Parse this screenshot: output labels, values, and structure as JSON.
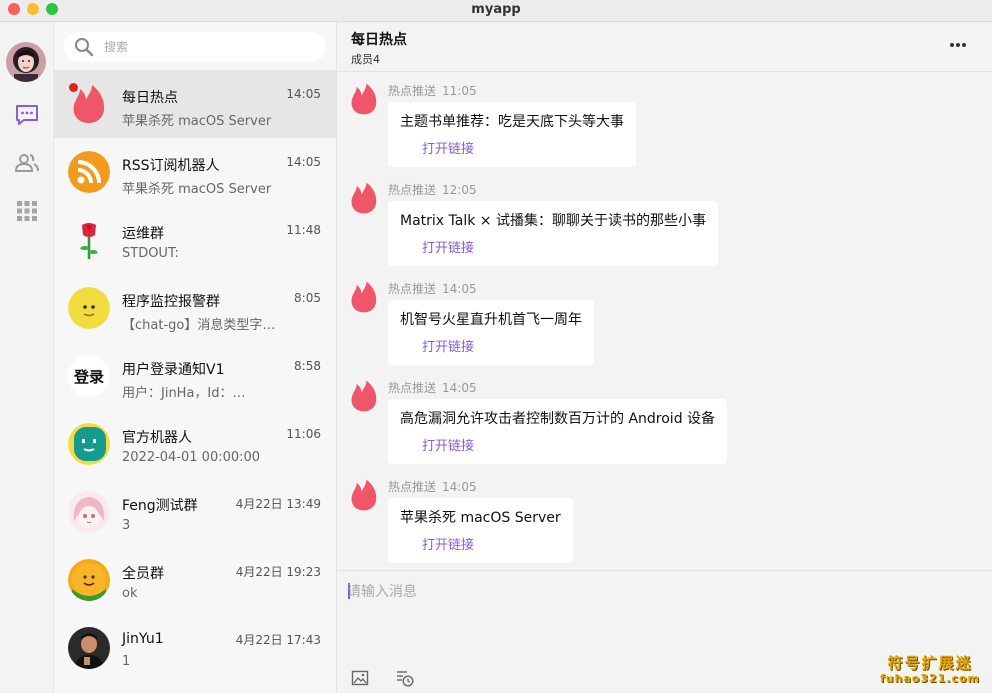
{
  "window": {
    "title": "myapp"
  },
  "rail": {
    "items": [
      {
        "icon": "chat-bubble-icon",
        "active": true
      },
      {
        "icon": "contacts-icon",
        "active": false
      },
      {
        "icon": "apps-grid-icon",
        "active": false
      }
    ]
  },
  "search": {
    "placeholder": "搜索",
    "value": ""
  },
  "conversations": [
    {
      "name": "每日热点",
      "time": "14:05",
      "preview": "苹果杀死 macOS Server",
      "avatar": "fire-logo",
      "active": true,
      "unread": true
    },
    {
      "name": "RSS订阅机器人",
      "time": "14:05",
      "preview": "苹果杀死 macOS Server",
      "avatar": "rss-logo"
    },
    {
      "name": "运维群",
      "time": "11:48",
      "preview": "STDOUT:",
      "avatar": "rose"
    },
    {
      "name": "程序监控报警群",
      "time": "8:05",
      "preview": "【chat-go】消息类型字段错误",
      "avatar": "yellow-face"
    },
    {
      "name": "用户登录通知V1",
      "time": "8:58",
      "preview": "用户：JinHa，Id：…",
      "avatar": "登录"
    },
    {
      "name": "官方机器人",
      "time": "11:06",
      "preview": "2022-04-01 00:00:00",
      "avatar": "bot-face"
    },
    {
      "name": "Feng测试群",
      "time": "4月22日 13:49",
      "preview": "3",
      "avatar": "anime-girl"
    },
    {
      "name": "全员群",
      "time": "4月22日 19:23",
      "preview": "ok",
      "avatar": "orange-face"
    },
    {
      "name": "JinYu1",
      "time": "4月22日 17:43",
      "preview": "1",
      "avatar": "person-photo"
    }
  ],
  "chat": {
    "title": "每日热点",
    "members": "成员4",
    "messages": [
      {
        "sender": "热点推送",
        "time": "11:05",
        "text": "主题书单推荐：吃是天底下头等大事",
        "link": "打开链接"
      },
      {
        "sender": "热点推送",
        "time": "12:05",
        "text": "Matrix Talk × 试播集：聊聊关于读书的那些小事",
        "link": "打开链接"
      },
      {
        "sender": "热点推送",
        "time": "14:05",
        "text": "机智号火星直升机首飞一周年",
        "link": "打开链接"
      },
      {
        "sender": "热点推送",
        "time": "14:05",
        "text": "高危漏洞允许攻击者控制数百万计的 Android 设备",
        "link": "打开链接"
      },
      {
        "sender": "热点推送",
        "time": "14:05",
        "text": "苹果杀死 macOS Server",
        "link": "打开链接"
      }
    ]
  },
  "composer": {
    "placeholder": "请输入消息",
    "value": ""
  },
  "watermark": {
    "line1": "符号扩展迷",
    "line2": "fuhao321.com"
  },
  "colors": {
    "accent": "#8a5cd6",
    "fire": "#f0566a",
    "unread": "#e02020"
  }
}
